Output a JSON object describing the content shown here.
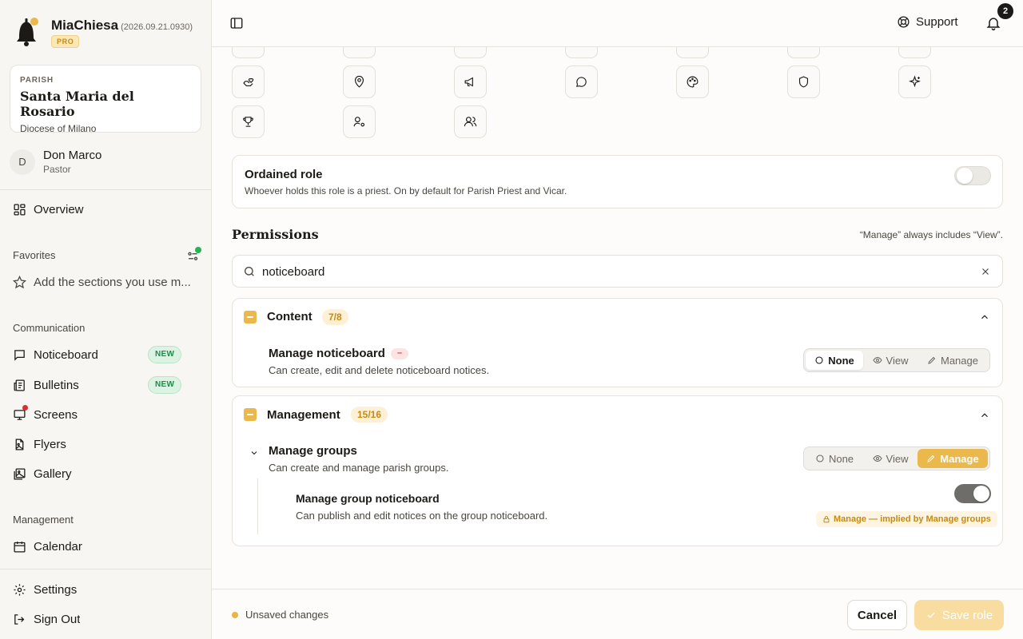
{
  "brand": {
    "name": "MiaChiesa",
    "version": "(2026.09.21.0930)",
    "plan": "PRO"
  },
  "parish": {
    "label": "PARISH",
    "name": "Santa Maria del Rosario",
    "diocese": "Diocese of Milano"
  },
  "user": {
    "initial": "D",
    "name": "Don Marco",
    "role": "Pastor"
  },
  "sidebar": {
    "overview": "Overview",
    "favorites": {
      "heading": "Favorites",
      "placeholder": "Add the sections you use m..."
    },
    "communication": {
      "heading": "Communication",
      "items": [
        {
          "label": "Noticeboard",
          "badge": "NEW",
          "icon": "message-square-icon"
        },
        {
          "label": "Bulletins",
          "badge": "NEW",
          "icon": "newspaper-icon"
        },
        {
          "label": "Screens",
          "icon": "monitor-icon",
          "has_alert_dot": true
        },
        {
          "label": "Flyers",
          "icon": "file-image-icon"
        },
        {
          "label": "Gallery",
          "icon": "images-icon"
        }
      ]
    },
    "management": {
      "heading": "Management",
      "items": [
        {
          "label": "Calendar",
          "icon": "calendar-icon"
        }
      ]
    },
    "settings": "Settings",
    "sign_out": "Sign Out"
  },
  "header": {
    "support": "Support",
    "notifications_count": "2"
  },
  "ordained_role": {
    "title": "Ordained role",
    "description": "Whoever holds this role is a priest. On by default for Parish Priest and Vicar.",
    "enabled": false
  },
  "permissions": {
    "title": "Permissions",
    "note": "“Manage” always includes “View”.",
    "search_value": "noticeboard",
    "options": {
      "none": "None",
      "view": "View",
      "manage": "Manage"
    },
    "groups": [
      {
        "title": "Content",
        "count": "7/8",
        "items": [
          {
            "name": "Manage noticeboard",
            "change_badge": "–",
            "description": "Can create, edit and delete noticeboard notices.",
            "level": "None"
          }
        ]
      },
      {
        "title": "Management",
        "count": "15/16",
        "items": [
          {
            "name": "Manage groups",
            "description": "Can create and manage parish groups.",
            "level": "Manage",
            "sub": {
              "name": "Manage group noticeboard",
              "description": "Can publish and edit notices on the group noticeboard.",
              "enabled": true,
              "implied_note": "Manage — implied by Manage groups"
            }
          }
        ]
      }
    ]
  },
  "footer": {
    "status": "Unsaved changes",
    "cancel": "Cancel",
    "save": "Save role"
  },
  "colors": {
    "accent": "#ebb84c",
    "new_badge": "#1f8a4c",
    "alert": "#d72e2e"
  }
}
